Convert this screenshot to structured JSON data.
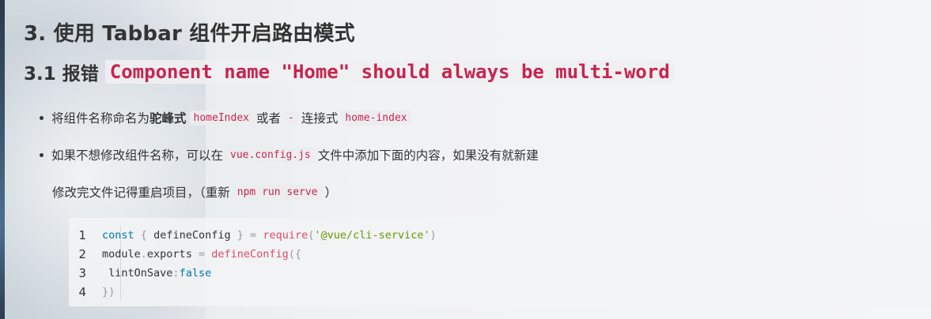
{
  "heading": "3. 使用 Tabbar 组件开启路由模式",
  "subheading": {
    "prefix": "3.1 报错",
    "code": "Component name \"Home\" should always be multi-word"
  },
  "bullets": [
    {
      "t1": "将组件名称命名为",
      "bold": "驼峰式",
      "code1": "homeIndex",
      "t2": "或者",
      "code2": "-",
      "t3": "连接式",
      "code3": "home-index"
    },
    {
      "t1": "如果不想修改组件名称，可以在",
      "code1": "vue.config.js",
      "t2": "文件中添加下面的内容，如果没有就新建"
    }
  ],
  "paragraph": {
    "t1": "修改完文件记得重启项目，（重新",
    "code": "npm run serve",
    "t2": "）"
  },
  "code_block": {
    "line_numbers": [
      "1",
      "2",
      "3",
      "4"
    ],
    "lines": [
      "const { defineConfig } = require('@vue/cli-service')",
      "module.exports = defineConfig({",
      " lintOnSave:false",
      "})"
    ]
  },
  "colors": {
    "inline_code": "#c7254e",
    "keyword": "#0077aa",
    "function": "#dd4a68",
    "string": "#669900",
    "punctuation": "#999999"
  }
}
